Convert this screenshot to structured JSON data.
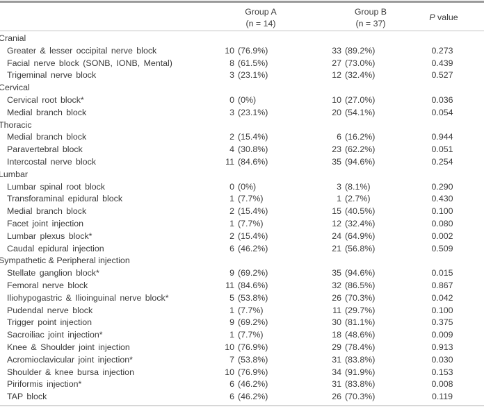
{
  "header": {
    "col_label": "",
    "group_a": {
      "name": "Group A",
      "n": "(n = 14)"
    },
    "group_b": {
      "name": "Group B",
      "n": "(n = 37)"
    },
    "p_value": {
      "italic": "P",
      "rest": " value"
    }
  },
  "sections": [
    {
      "category": "Cranial",
      "rows": [
        {
          "label": "Greater & lesser occipital nerve block",
          "a_n": "10",
          "a_pct": "(76.9%)",
          "b_n": "33",
          "b_pct": "(89.2%)",
          "p": "0.273"
        },
        {
          "label": "Facial nerve block (SONB, IONB, Mental)",
          "a_n": "8",
          "a_pct": "(61.5%)",
          "b_n": "27",
          "b_pct": "(73.0%)",
          "p": "0.439"
        },
        {
          "label": "Trigeminal nerve block",
          "a_n": "3",
          "a_pct": "(23.1%)",
          "b_n": "12",
          "b_pct": "(32.4%)",
          "p": "0.527"
        }
      ]
    },
    {
      "category": "Cervical",
      "rows": [
        {
          "label": "Cervical root block*",
          "a_n": "0",
          "a_pct": "(0%)",
          "b_n": "10",
          "b_pct": "(27.0%)",
          "p": "0.036"
        },
        {
          "label": "Medial branch block",
          "a_n": "3",
          "a_pct": "(23.1%)",
          "b_n": "20",
          "b_pct": "(54.1%)",
          "p": "0.054"
        }
      ]
    },
    {
      "category": "Thoracic",
      "rows": [
        {
          "label": "Medial branch block",
          "a_n": "2",
          "a_pct": "(15.4%)",
          "b_n": "6",
          "b_pct": "(16.2%)",
          "p": "0.944"
        },
        {
          "label": "Paravertebral block",
          "a_n": "4",
          "a_pct": "(30.8%)",
          "b_n": "23",
          "b_pct": "(62.2%)",
          "p": "0.051"
        },
        {
          "label": "Intercostal nerve block",
          "a_n": "11",
          "a_pct": "(84.6%)",
          "b_n": "35",
          "b_pct": "(94.6%)",
          "p": "0.254"
        }
      ]
    },
    {
      "category": "Lumbar",
      "rows": [
        {
          "label": "Lumbar spinal root block",
          "a_n": "0",
          "a_pct": "(0%)",
          "b_n": "3",
          "b_pct": "(8.1%)",
          "p": "0.290"
        },
        {
          "label": "Transforaminal epidural block",
          "a_n": "1",
          "a_pct": "(7.7%)",
          "b_n": "1",
          "b_pct": "(2.7%)",
          "p": "0.430"
        },
        {
          "label": "Medial branch block",
          "a_n": "2",
          "a_pct": "(15.4%)",
          "b_n": "15",
          "b_pct": "(40.5%)",
          "p": "0.100"
        },
        {
          "label": "Facet joint injection",
          "a_n": "1",
          "a_pct": "(7.7%)",
          "b_n": "12",
          "b_pct": "(32.4%)",
          "p": "0.080"
        },
        {
          "label": "Lumbar plexus block*",
          "a_n": "2",
          "a_pct": "(15.4%)",
          "b_n": "24",
          "b_pct": "(64.9%)",
          "p": "0.002"
        },
        {
          "label": "Caudal epidural injection",
          "a_n": "6",
          "a_pct": "(46.2%)",
          "b_n": "21",
          "b_pct": "(56.8%)",
          "p": "0.509"
        }
      ]
    },
    {
      "category": "Sympathetic & Peripheral injection",
      "rows": [
        {
          "label": "Stellate ganglion block*",
          "a_n": "9",
          "a_pct": "(69.2%)",
          "b_n": "35",
          "b_pct": "(94.6%)",
          "p": "0.015"
        },
        {
          "label": "Femoral nerve block",
          "a_n": "11",
          "a_pct": "(84.6%)",
          "b_n": "32",
          "b_pct": "(86.5%)",
          "p": "0.867"
        },
        {
          "label": "Iliohypogastric & Ilioinguinal nerve block*",
          "a_n": "5",
          "a_pct": "(53.8%)",
          "b_n": "26",
          "b_pct": "(70.3%)",
          "p": "0.042"
        },
        {
          "label": "Pudendal nerve block",
          "a_n": "1",
          "a_pct": "(7.7%)",
          "b_n": "11",
          "b_pct": "(29.7%)",
          "p": "0.100"
        },
        {
          "label": "Trigger point injection",
          "a_n": "9",
          "a_pct": "(69.2%)",
          "b_n": "30",
          "b_pct": "(81.1%)",
          "p": "0.375"
        },
        {
          "label": "Sacroiliac joint injection*",
          "a_n": "1",
          "a_pct": "(7.7%)",
          "b_n": "18",
          "b_pct": "(48.6%)",
          "p": "0.009"
        },
        {
          "label": "Knee & Shoulder joint injection",
          "a_n": "10",
          "a_pct": "(76.9%)",
          "b_n": "29",
          "b_pct": "(78.4%)",
          "p": "0.913"
        },
        {
          "label": "Acromioclavicular joint injection*",
          "a_n": "7",
          "a_pct": "(53.8%)",
          "b_n": "31",
          "b_pct": "(83.8%)",
          "p": "0.030"
        },
        {
          "label": "Shoulder & knee bursa injection",
          "a_n": "10",
          "a_pct": "(76.9%)",
          "b_n": "34",
          "b_pct": "(91.9%)",
          "p": "0.153"
        },
        {
          "label": "Piriformis injection*",
          "a_n": "6",
          "a_pct": "(46.2%)",
          "b_n": "31",
          "b_pct": "(83.8%)",
          "p": "0.008"
        },
        {
          "label": "TAP block",
          "a_n": "6",
          "a_pct": "(46.2%)",
          "b_n": "26",
          "b_pct": "(70.3%)",
          "p": "0.119"
        }
      ]
    }
  ]
}
